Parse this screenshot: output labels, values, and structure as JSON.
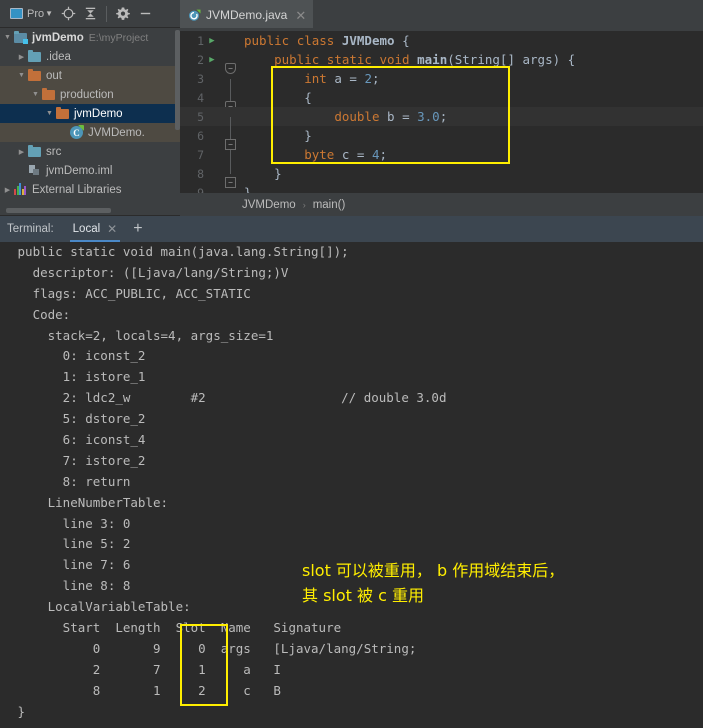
{
  "toolbar": {
    "project_button_label": "Pro",
    "icons": [
      "project-window-icon",
      "locate-icon",
      "collapse-all-icon",
      "settings-gear-icon",
      "hide-icon"
    ]
  },
  "tabs": [
    {
      "label": "JVMDemo.java",
      "icon": "java-class-icon",
      "close": "✕",
      "active": true
    }
  ],
  "project_tree": {
    "items": [
      {
        "indent": 0,
        "arrow": "down",
        "icon": "module-icon",
        "label": "jvmDemo",
        "path": "E:\\myProject",
        "bold": true,
        "state": "normal"
      },
      {
        "indent": 1,
        "arrow": "right",
        "icon": "folder-blue-icon",
        "label": ".idea",
        "path": "",
        "bold": false,
        "state": "normal"
      },
      {
        "indent": 1,
        "arrow": "down",
        "icon": "folder-orange-icon",
        "label": "out",
        "path": "",
        "bold": false,
        "state": "excluded"
      },
      {
        "indent": 2,
        "arrow": "down",
        "icon": "folder-orange-icon",
        "label": "production",
        "path": "",
        "bold": false,
        "state": "excluded"
      },
      {
        "indent": 3,
        "arrow": "down",
        "icon": "folder-orange-icon",
        "label": "jvmDemo",
        "path": "",
        "bold": false,
        "state": "selected"
      },
      {
        "indent": 4,
        "arrow": "none",
        "icon": "java-class-icon",
        "label": "JVMDemo.",
        "path": "",
        "bold": false,
        "state": "excluded"
      },
      {
        "indent": 1,
        "arrow": "right",
        "icon": "folder-blue-icon",
        "label": "src",
        "path": "",
        "bold": false,
        "state": "normal"
      },
      {
        "indent": 1,
        "arrow": "none",
        "icon": "iml-file-icon",
        "label": "jvmDemo.iml",
        "path": "",
        "bold": false,
        "state": "normal"
      },
      {
        "indent": 0,
        "arrow": "right",
        "icon": "library-icon",
        "label": "External Libraries",
        "path": "",
        "bold": false,
        "state": "normal"
      }
    ]
  },
  "editor": {
    "lines": [
      {
        "num": "1",
        "run": true,
        "fold": "none",
        "bar": false,
        "current": false,
        "tokens": [
          {
            "t": "public ",
            "c": "k"
          },
          {
            "t": "class ",
            "c": "k"
          },
          {
            "t": "JVMDemo ",
            "c": "nm"
          },
          {
            "t": "{",
            "c": "pl"
          }
        ]
      },
      {
        "num": "2",
        "run": true,
        "fold": "rounded",
        "bar": false,
        "current": false,
        "tokens": [
          {
            "t": "    public ",
            "c": "k"
          },
          {
            "t": "static ",
            "c": "k"
          },
          {
            "t": "void ",
            "c": "k"
          },
          {
            "t": "main",
            "c": "nm"
          },
          {
            "t": "(String[] args) {",
            "c": "pl"
          }
        ]
      },
      {
        "num": "3",
        "run": false,
        "fold": "none",
        "bar": true,
        "current": false,
        "tokens": [
          {
            "t": "        ",
            "c": "pl"
          },
          {
            "t": "int ",
            "c": "k"
          },
          {
            "t": "a ",
            "c": "pl"
          },
          {
            "t": "= ",
            "c": "pl"
          },
          {
            "t": "2",
            "c": "num"
          },
          {
            "t": ";",
            "c": "pl"
          }
        ]
      },
      {
        "num": "4",
        "run": false,
        "fold": "rounded",
        "bar": true,
        "current": false,
        "tokens": [
          {
            "t": "        {",
            "c": "pl"
          }
        ]
      },
      {
        "num": "5",
        "run": false,
        "fold": "none",
        "bar": true,
        "current": true,
        "tokens": [
          {
            "t": "            ",
            "c": "pl"
          },
          {
            "t": "double ",
            "c": "k"
          },
          {
            "t": "b ",
            "c": "pl"
          },
          {
            "t": "= ",
            "c": "pl"
          },
          {
            "t": "3.0",
            "c": "num"
          },
          {
            "t": ";",
            "c": "pl"
          }
        ]
      },
      {
        "num": "6",
        "run": false,
        "fold": "square",
        "bar": true,
        "current": false,
        "tokens": [
          {
            "t": "        }",
            "c": "pl"
          }
        ]
      },
      {
        "num": "7",
        "run": false,
        "fold": "none",
        "bar": true,
        "current": false,
        "tokens": [
          {
            "t": "        ",
            "c": "pl"
          },
          {
            "t": "byte ",
            "c": "k"
          },
          {
            "t": "c ",
            "c": "pl"
          },
          {
            "t": "= ",
            "c": "pl"
          },
          {
            "t": "4",
            "c": "num"
          },
          {
            "t": ";",
            "c": "pl"
          }
        ]
      },
      {
        "num": "8",
        "run": false,
        "fold": "square",
        "bar": false,
        "current": false,
        "tokens": [
          {
            "t": "    }",
            "c": "pl"
          }
        ]
      },
      {
        "num": "9",
        "run": false,
        "fold": "none",
        "bar": false,
        "current": false,
        "tokens": [
          {
            "t": "}",
            "c": "pl"
          }
        ]
      }
    ],
    "highlight_color": "#ffee00"
  },
  "breadcrumb": {
    "class": "JVMDemo",
    "separator": "›",
    "method": "main()"
  },
  "terminal": {
    "label": "Terminal:",
    "tab_label": "Local",
    "tab_close": "✕",
    "add_label": "+",
    "lines": [
      " public static void main(java.lang.String[]);",
      "   descriptor: ([Ljava/lang/String;)V",
      "   flags: ACC_PUBLIC, ACC_STATIC",
      "   Code:",
      "     stack=2, locals=4, args_size=1",
      "       0: iconst_2",
      "       1: istore_1",
      "       2: ldc2_w        #2                  // double 3.0d",
      "       5: dstore_2",
      "       6: iconst_4",
      "       7: istore_2",
      "       8: return",
      "     LineNumberTable:",
      "       line 3: 0",
      "       line 5: 2",
      "       line 7: 6",
      "       line 8: 8",
      "     LocalVariableTable:",
      "       Start  Length  Slot  Name   Signature",
      "           0       9     0  args   [Ljava/lang/String;",
      "           2       7     1     a   I",
      "           8       1     2     c   B",
      " }"
    ]
  },
  "annotation": {
    "line1": "slot 可以被重用， b 作用域结束后，",
    "line2": "其 slot 被 c 重用",
    "color": "#ffee00"
  },
  "colors": {
    "background": "#2b2b2b",
    "panel": "#3c3f41",
    "selection": "#0d2f4f",
    "excluded": "#4e4a42",
    "highlight": "#ffee00",
    "keyword": "#cc7832",
    "number": "#6897bb",
    "plain": "#a9b7c6",
    "terminal_accent": "#4a88c7"
  }
}
